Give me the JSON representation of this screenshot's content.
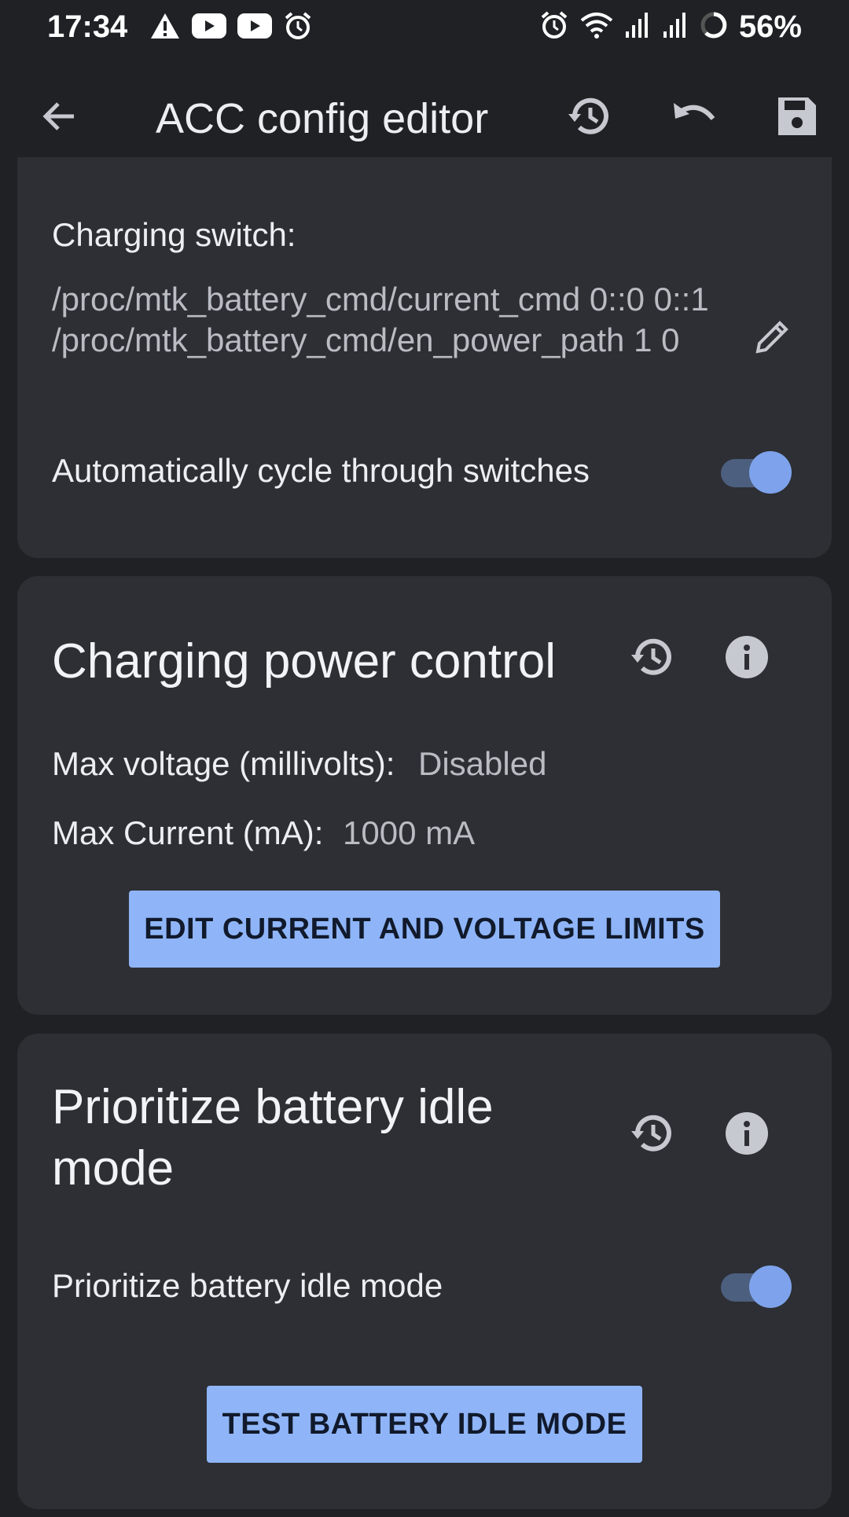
{
  "status_bar": {
    "time": "17:34",
    "battery_percent": "56%",
    "left_icons": [
      "warning-icon",
      "youtube-icon",
      "youtube-icon",
      "alarm-icon"
    ],
    "right_icons": [
      "alarm-icon",
      "wifi-icon",
      "signal-icon",
      "signal-icon",
      "battery-ring-icon"
    ]
  },
  "app_bar": {
    "title": "ACC config editor",
    "actions": [
      "back-arrow-icon",
      "history-icon",
      "undo-icon",
      "save-icon"
    ]
  },
  "charging_switch_card": {
    "label": "Charging switch:",
    "value": "/proc/mtk_battery_cmd/current_cmd 0::0 0::1 /proc/mtk_battery_cmd/en_power_path 1 0",
    "auto_cycle_label": "Automatically cycle through switches",
    "auto_cycle_enabled": true
  },
  "power_control_card": {
    "title": "Charging power control",
    "max_voltage_label": "Max voltage (millivolts):",
    "max_voltage_value": "Disabled",
    "max_current_label": "Max Current (mA):",
    "max_current_value": "1000 mA",
    "edit_button_label": "EDIT CURRENT AND VOLTAGE LIMITS"
  },
  "idle_mode_card": {
    "title": "Prioritize battery idle mode",
    "toggle_label": "Prioritize battery idle mode",
    "toggle_enabled": true,
    "test_button_label": "TEST BATTERY IDLE MODE"
  },
  "colors": {
    "background": "#1f2125",
    "card": "#2d2f34",
    "accent": "#8fb5f8",
    "toggle_thumb": "#7ea3ec"
  }
}
